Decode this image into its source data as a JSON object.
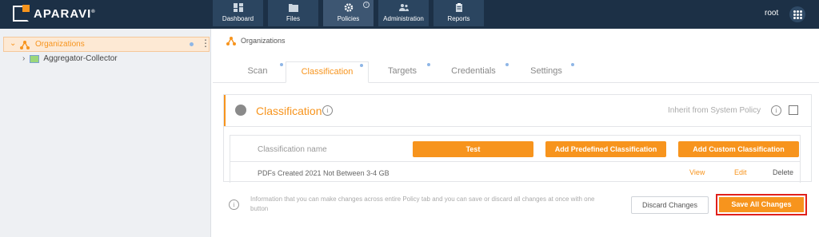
{
  "brand": {
    "name": "APARAVI",
    "mark": "®"
  },
  "nav": [
    {
      "label": "Dashboard",
      "icon": "dashboard-icon",
      "active": false
    },
    {
      "label": "Files",
      "icon": "folder-icon",
      "active": false
    },
    {
      "label": "Policies",
      "icon": "gear-icon",
      "active": true
    },
    {
      "label": "Administration",
      "icon": "users-icon",
      "active": false
    },
    {
      "label": "Reports",
      "icon": "clipboard-icon",
      "active": false
    }
  ],
  "user": {
    "name": "root"
  },
  "sidebar": {
    "items": [
      {
        "label": "Organizations",
        "selected": true,
        "expanded": true
      },
      {
        "label": "Aggregator-Collector",
        "selected": false,
        "expanded": false
      }
    ]
  },
  "breadcrumb": {
    "label": "Organizations"
  },
  "tabs": [
    {
      "label": "Scan",
      "active": false
    },
    {
      "label": "Classification",
      "active": true
    },
    {
      "label": "Targets",
      "active": false
    },
    {
      "label": "Credentials",
      "active": false
    },
    {
      "label": "Settings",
      "active": false
    }
  ],
  "panel": {
    "title": "Classification",
    "inherit_label": "Inherit from System Policy",
    "inherit_checked": false,
    "table": {
      "header": "Classification name",
      "buttons": {
        "test": "Test",
        "add_predefined": "Add Predefined Classification",
        "add_custom": "Add Custom Classification"
      },
      "rows": [
        {
          "name": "PDFs Created 2021 Not Between 3-4 GB",
          "view": "View",
          "edit": "Edit",
          "delete": "Delete"
        }
      ]
    }
  },
  "footer": {
    "info_text": "Information that you can make changes across entire Policy tab and you can save or discard all changes at once with one button",
    "discard": "Discard Changes",
    "save": "Save All Changes"
  },
  "colors": {
    "accent": "#f7941d",
    "topbar": "#1c3046",
    "highlight_border": "#e0201b"
  }
}
